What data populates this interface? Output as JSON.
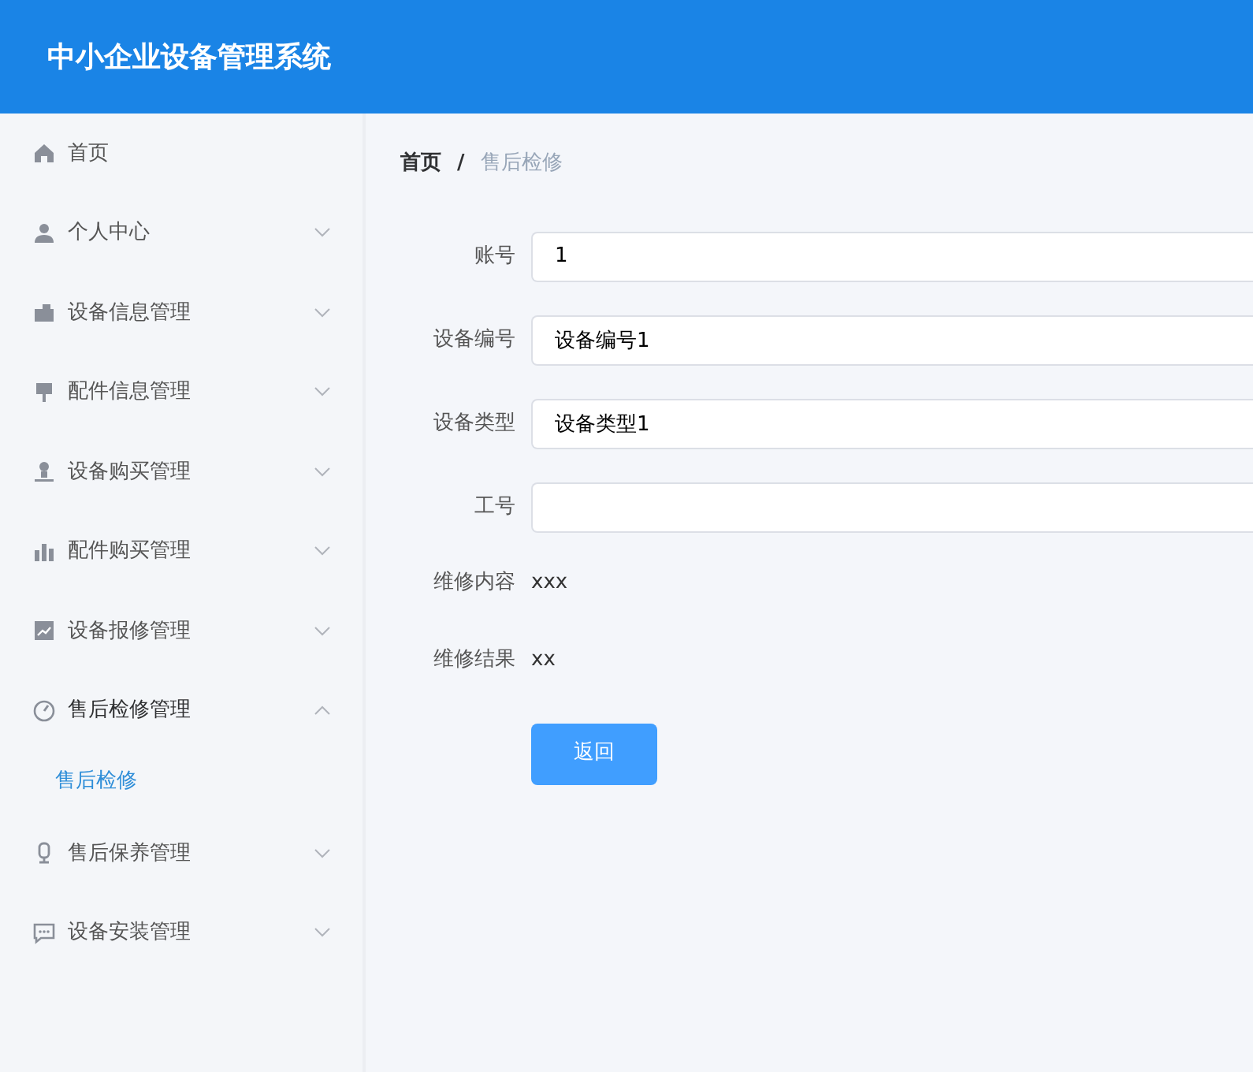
{
  "header": {
    "title": "中小企业设备管理系统"
  },
  "sidebar": {
    "items": [
      {
        "label": "首页",
        "kind": "link"
      },
      {
        "label": "个人中心",
        "kind": "group",
        "expanded": false
      },
      {
        "label": "设备信息管理",
        "kind": "group",
        "expanded": false
      },
      {
        "label": "配件信息管理",
        "kind": "group",
        "expanded": false
      },
      {
        "label": "设备购买管理",
        "kind": "group",
        "expanded": false
      },
      {
        "label": "配件购买管理",
        "kind": "group",
        "expanded": false
      },
      {
        "label": "设备报修管理",
        "kind": "group",
        "expanded": false
      },
      {
        "label": "售后检修管理",
        "kind": "group",
        "expanded": true,
        "children": [
          {
            "label": "售后检修",
            "selected": true
          }
        ]
      },
      {
        "label": "售后保养管理",
        "kind": "group",
        "expanded": false
      },
      {
        "label": "设备安装管理",
        "kind": "group",
        "expanded": false
      }
    ]
  },
  "breadcrumb": {
    "separator": "/",
    "items": [
      {
        "label": "首页",
        "current": false
      },
      {
        "label": "售后检修",
        "current": true
      }
    ]
  },
  "form": {
    "fields": [
      {
        "label": "账号",
        "kind": "input",
        "value": "1"
      },
      {
        "label": "设备编号",
        "kind": "input",
        "value": "设备编号1"
      },
      {
        "label": "设备类型",
        "kind": "input",
        "value": "设备类型1"
      },
      {
        "label": "工号",
        "kind": "input"
      },
      {
        "label": "维修内容",
        "kind": "text",
        "value": "xxx"
      },
      {
        "label": "维修结果",
        "kind": "text",
        "value": "xx"
      }
    ],
    "button": "返回"
  }
}
